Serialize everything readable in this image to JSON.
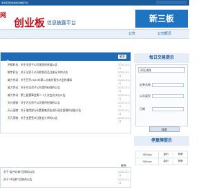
{
  "topbar": {
    "left_text": "欢迎来到创业板信息披露平台"
  },
  "header": {
    "net_label": "网",
    "logo": "创业板",
    "subtitle": "信息披露平台",
    "banner": "新三板"
  },
  "nav": {
    "items": [
      "公告",
      "公司概况"
    ]
  },
  "news": {
    "section_title": "公告",
    "more_label": "更多",
    "rows": [
      {
        "title": "洪都科技：关于全资子公司增资的进展公告",
        "date": "2023-01-11"
      },
      {
        "title": "钢宇药业：关于全资子公司收到药品注册证书的公告",
        "date": "2023-01-11"
      },
      {
        "title": "威力传动：关于召开2023年第二次临时股东大会的通知",
        "date": "2023-01-11"
      },
      {
        "title": "威力传动：关于对全资子公司提供担保的公告",
        "date": "2023-01-11"
      },
      {
        "title": "威力传动：第三届董事会第二十九次会议决议公告",
        "date": "2023-01-11"
      },
      {
        "title": "天元宠物：关于为全资子公司提供担保的公告",
        "date": "2023-01-11"
      },
      {
        "title": "天元宠物：关于使用部分闲置募集资金进行现金管理的进展公告",
        "date": "2023-01-11"
      },
      {
        "title": "天元宠物：关于变更签字注册会计师的公告",
        "date": "2023-01-11"
      }
    ]
  },
  "news2": {
    "more_label": "更多",
    "rows": [
      {
        "title": "关于\"盐中化转\"回购的公告",
        "date": "2023-01-11"
      },
      {
        "title": "关于\"中化转\"回购的公告",
        "date": "2023-01-11"
      }
    ]
  },
  "sidebar": {
    "daily_title": "每日交易提示",
    "select_value": "深证成指",
    "fields": [
      {
        "label": "证券名称"
      },
      {
        "label": "公告类型"
      },
      {
        "label": "日期"
      }
    ],
    "search_label": "搜索",
    "rehab_title": "停复牌提示",
    "rehab_rows": [
      {
        "code": "300xxx",
        "name": "金利",
        "type": "停牌"
      },
      {
        "code": "300xxx",
        "name": "金利",
        "type": "停牌"
      }
    ]
  }
}
